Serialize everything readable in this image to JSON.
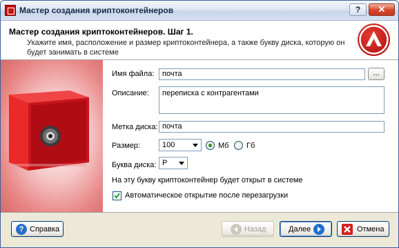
{
  "window": {
    "title": "Мастер создания криптоконтейнеров",
    "help_glyph": "?",
    "close_glyph": "✕"
  },
  "header": {
    "title": "Мастер создания криптоконтейнеров. Шаг 1.",
    "description": "Укажите имя, расположение и размер криптоконтейнера, а также букву диска, которую он будет занимать в системе"
  },
  "form": {
    "file_name_label": "Имя файла:",
    "file_name_value": "почта",
    "browse_label": "...",
    "description_label": "Описание:",
    "description_value": "переписка с контрагентами",
    "disk_label_label": "Метка диска:",
    "disk_label_value": "почта",
    "size_label": "Размер:",
    "size_value": "100",
    "unit_mb": "Мб",
    "unit_gb": "Гб",
    "unit_selected": "Мб",
    "drive_letter_label": "Буква диска:",
    "drive_letter_value": "P",
    "drive_info": "На эту букву криптоконтейнер будет открыт в системе",
    "auto_open_label": "Автоматическое открытие после перезагрузки",
    "auto_open_checked": true
  },
  "footer": {
    "help": "Справка",
    "back": "Назад",
    "next": "Далее",
    "cancel": "Отмена"
  },
  "colors": {
    "accent_red": "#c41010",
    "field_border": "#7f9db9",
    "next_blue": "#1f6fd1",
    "cancel_red": "#d32020"
  }
}
